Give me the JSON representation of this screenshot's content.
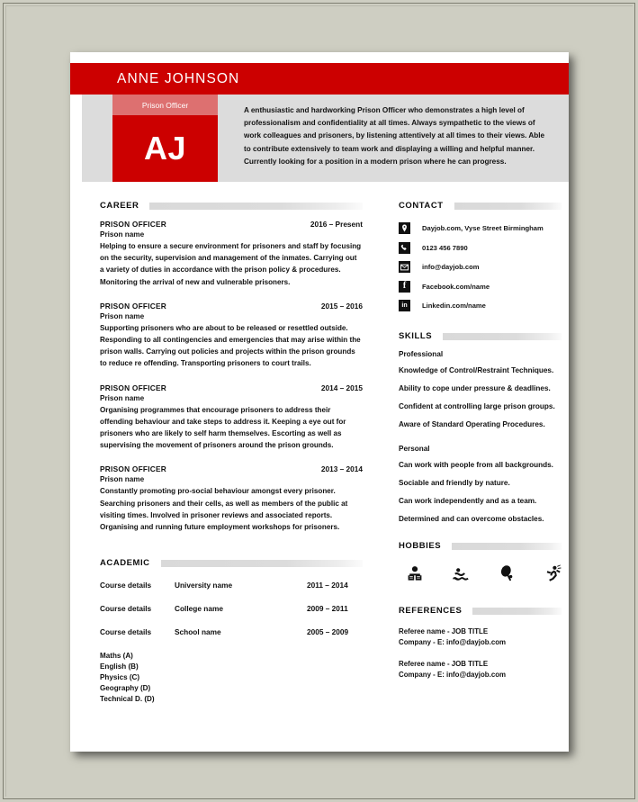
{
  "document": {
    "type": "resume",
    "background_color": "#cecec2",
    "accent_color": "#cc0000",
    "accent_light_color": "#dd7070",
    "band_color": "#dcdcdc"
  },
  "header": {
    "full_name": "ANNE JOHNSON",
    "job_title_chip": "Prison Officer",
    "initials": "AJ",
    "profile_summary": "A enthusiastic and hardworking Prison Officer who demonstrates a high level of professionalism and confidentiality at all times. Always sympathetic to the views of work colleagues and prisoners, by listening attentively at all times to their views. Able to contribute extensively to team work and displaying a willing and helpful manner. Currently looking for a position in a modern prison where he can progress."
  },
  "career": {
    "heading": "CAREER",
    "jobs": [
      {
        "title": "PRISON OFFICER",
        "dates": "2016 – Present",
        "company": "Prison name",
        "description": "Helping to ensure a secure environment for prisoners and staff by focusing on the security, supervision and management of the inmates. Carrying out a variety of duties in accordance with the prison policy & procedures. Monitoring the arrival of new and vulnerable prisoners."
      },
      {
        "title": "PRISON OFFICER",
        "dates": "2015 – 2016",
        "company": "Prison name",
        "description": "Supporting prisoners who are about to be released or resettled outside. Responding to all contingencies and emergencies that may arise within the prison walls. Carrying out policies and projects within the prison grounds to reduce re offending. Transporting prisoners to court trails."
      },
      {
        "title": "PRISON OFFICER",
        "dates": "2014 – 2015",
        "company": "Prison name",
        "description": "Organising programmes that encourage prisoners to address their offending behaviour and take steps to address it. Keeping a eye out for prisoners who are likely to self harm themselves. Escorting as well as supervising the movement of prisoners around the prison grounds."
      },
      {
        "title": "PRISON OFFICER",
        "dates": "2013 – 2014",
        "company": "Prison name",
        "description": "Constantly promoting pro-social behaviour amongst every prisoner. Searching prisoners and their cells, as well as members of the public at visiting times. Involved in prisoner reviews and associated reports. Organising and running future employment workshops for prisoners."
      }
    ]
  },
  "academic": {
    "heading": "ACADEMIC",
    "entries": [
      {
        "course": "Course details",
        "institution": "University name",
        "dates": "2011 – 2014"
      },
      {
        "course": "Course details",
        "institution": "College name",
        "dates": "2009 – 2011"
      },
      {
        "course": "Course details",
        "institution": "School name",
        "dates": "2005 – 2009"
      }
    ],
    "grades": [
      "Maths (A)",
      "English (B)",
      "Physics (C)",
      "Geography (D)",
      "Technical D. (D)"
    ]
  },
  "contact": {
    "heading": "CONTACT",
    "items": [
      {
        "icon": "location-pin-icon",
        "text": "Dayjob.com, Vyse Street Birmingham"
      },
      {
        "icon": "phone-icon",
        "text": "0123 456 7890"
      },
      {
        "icon": "email-icon",
        "text": "info@dayjob.com"
      },
      {
        "icon": "facebook-icon",
        "text": "Facebook.com/name"
      },
      {
        "icon": "linkedin-icon",
        "text": "Linkedin.com/name"
      }
    ]
  },
  "skills": {
    "heading": "SKILLS",
    "professional_label": "Professional",
    "professional": [
      "Knowledge of Control/Restraint Techniques.",
      "Ability to cope under pressure & deadlines.",
      "Confident at controlling large prison groups.",
      "Aware of Standard Operating Procedures."
    ],
    "personal_label": "Personal",
    "personal": [
      "Can work with people from all backgrounds.",
      "Sociable and friendly by nature.",
      "Can work independently and as a team.",
      "Determined and can overcome obstacles."
    ]
  },
  "hobbies": {
    "heading": "HOBBIES",
    "icons": [
      "reading-icon",
      "swimming-icon",
      "tennis-racquet-icon",
      "running-icon"
    ]
  },
  "references": {
    "heading": "REFERENCES",
    "items": [
      {
        "line1": "Referee name - JOB TITLE",
        "line2": "Company - E: info@dayjob.com"
      },
      {
        "line1": "Referee name - JOB TITLE",
        "line2": "Company - E: info@dayjob.com"
      }
    ]
  }
}
